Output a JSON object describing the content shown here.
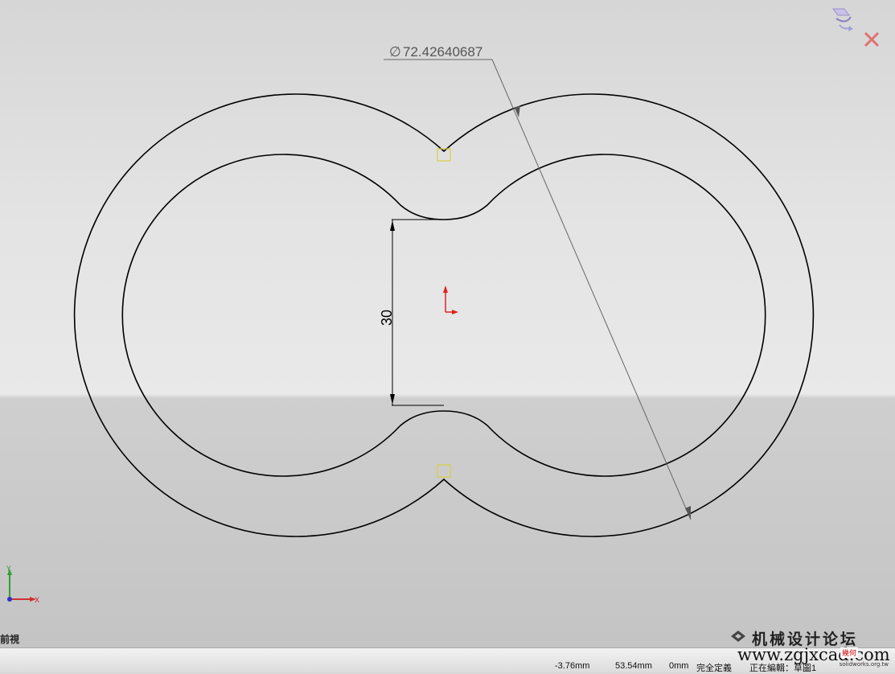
{
  "dimensions": {
    "diameter": "72.42640687",
    "diameter_symbol": "∅",
    "linear": "30"
  },
  "view": {
    "orientation_label": "前視"
  },
  "triad": {
    "x_label": "X",
    "y_label": "Y"
  },
  "status_bar": {
    "x_coord": "-3.76mm",
    "y_coord": "53.54mm",
    "z_coord": "0mm",
    "definition_state": "完全定義",
    "editing": "正在編輯：草圖1"
  },
  "watermark": {
    "title": "机械设计论坛",
    "url": "www.zgjxcad.com",
    "badge": "幾何",
    "small": "solidworks.org.tw"
  },
  "colors": {
    "sketch_line": "#000000",
    "origin": "#e02020",
    "relation_marker": "#d8d040",
    "triad_x": "#d03030",
    "triad_y": "#30a030",
    "triad_z": "#3030d0"
  }
}
